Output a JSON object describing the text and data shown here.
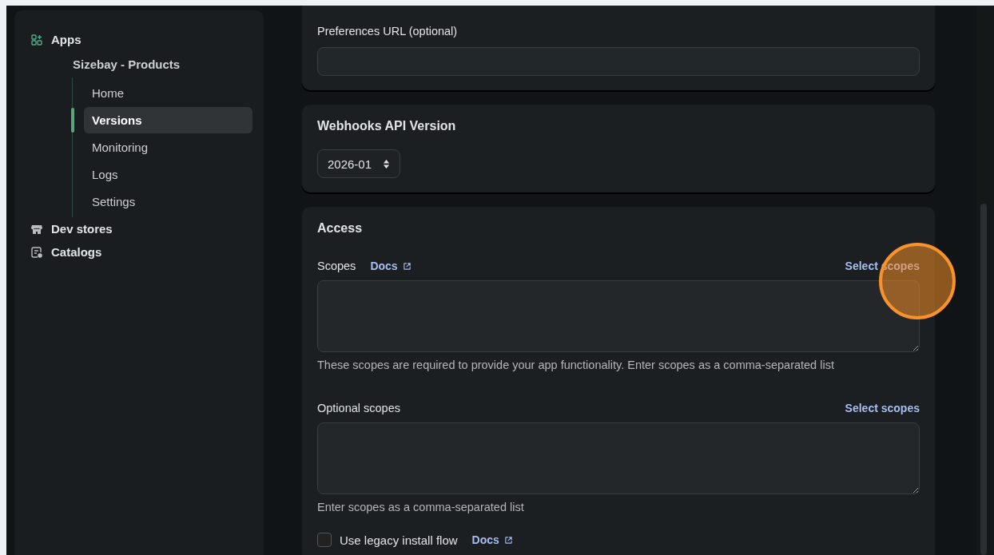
{
  "sidebar": {
    "items": [
      {
        "label": "Apps",
        "selected": false,
        "children": [
          {
            "label": "Sizebay - Products",
            "children": [
              {
                "label": "Home",
                "selected": false
              },
              {
                "label": "Versions",
                "selected": true
              },
              {
                "label": "Monitoring",
                "selected": false
              },
              {
                "label": "Logs",
                "selected": false
              },
              {
                "label": "Settings",
                "selected": false
              }
            ]
          }
        ]
      },
      {
        "label": "Dev stores",
        "selected": false
      },
      {
        "label": "Catalogs",
        "selected": false
      }
    ]
  },
  "preferences": {
    "label": "Preferences URL (optional)"
  },
  "webhooks": {
    "title": "Webhooks API Version",
    "version": "2026-01"
  },
  "access": {
    "title": "Access",
    "scopes": {
      "label": "Scopes",
      "docs": "Docs",
      "action": "Select scopes",
      "help": "These scopes are required to provide your app functionality. Enter scopes as a comma-separated list"
    },
    "optional_scopes": {
      "label": "Optional scopes",
      "action": "Select scopes",
      "help": "Enter scopes as a comma-separated list"
    },
    "legacy": {
      "label": "Use legacy install flow",
      "docs": "Docs",
      "checked": false
    }
  }
}
